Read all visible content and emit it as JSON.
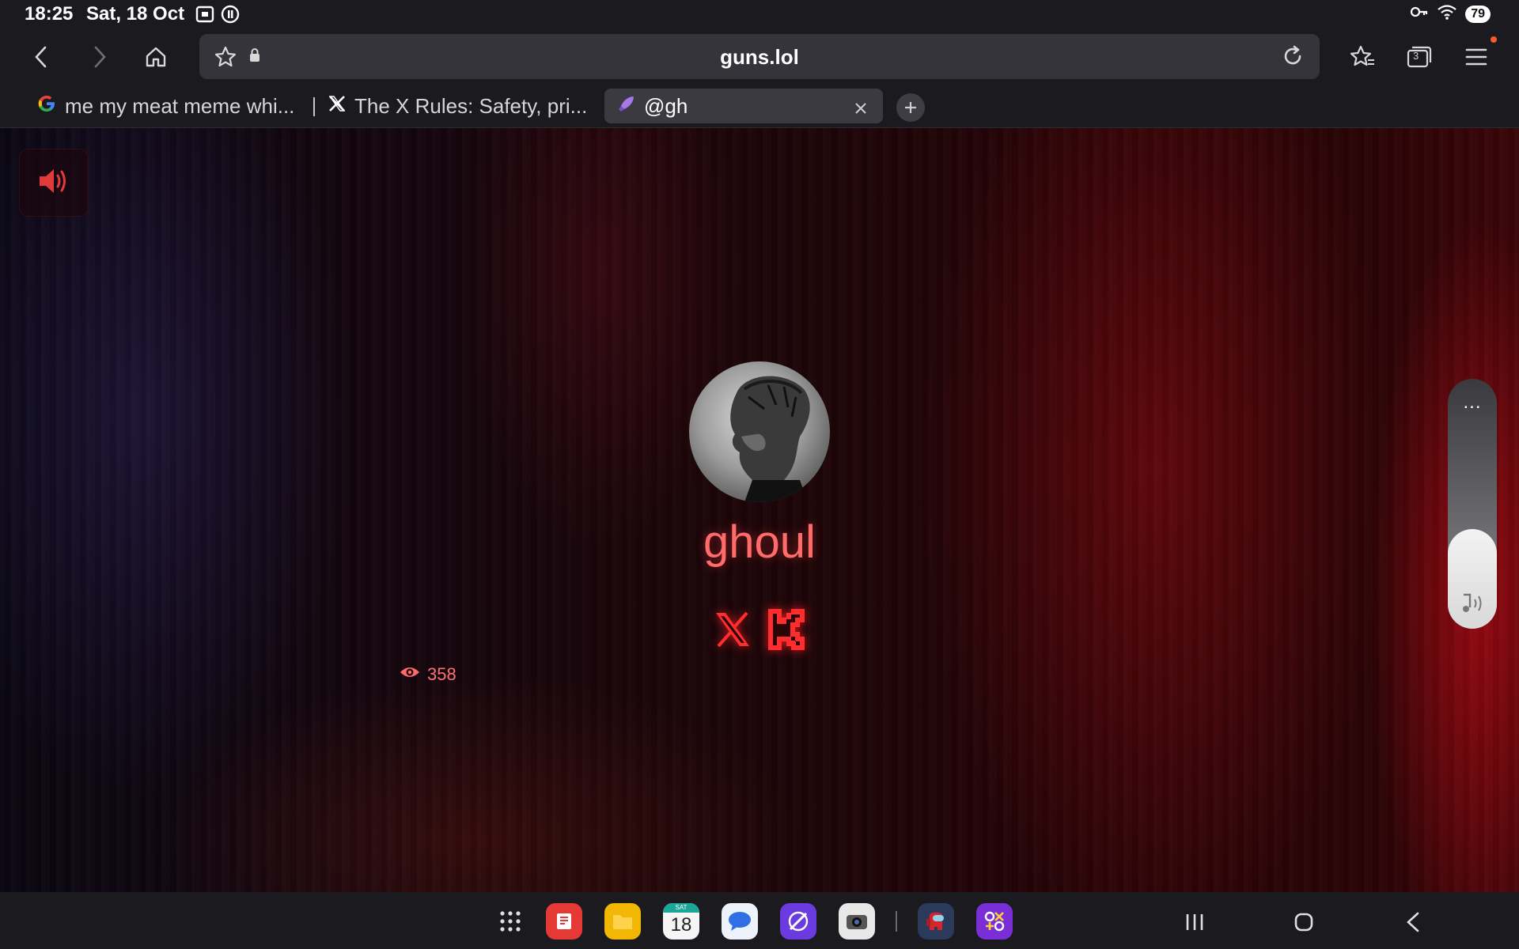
{
  "status_bar": {
    "time": "18:25",
    "date": "Sat, 18 Oct",
    "battery": "79",
    "left_icons": [
      "screen-record-icon",
      "alarm-icon"
    ],
    "right_icons": [
      "key-icon",
      "wifi-icon",
      "battery-icon"
    ]
  },
  "browser": {
    "url": "guns.lol",
    "tab_count": "3",
    "tabs": [
      {
        "title": "me my meat meme whi...",
        "favicon": "google-icon",
        "active": false
      },
      {
        "title": "The X Rules: Safety, pri...",
        "favicon": "x-logo-icon",
        "active": false
      },
      {
        "title": "@gh",
        "favicon": "rocket-icon",
        "active": true
      }
    ]
  },
  "profile": {
    "username": "ghoul",
    "views": "358",
    "socials": [
      "x-icon",
      "kick-icon"
    ]
  },
  "volume_panel": {
    "menu_label": "...",
    "level": 0.4
  },
  "dock": {
    "apps": [
      "app-drawer-icon",
      "notes-app-icon",
      "files-app-icon",
      "calendar-app-icon",
      "messages-app-icon",
      "internet-app-icon",
      "camera-app-icon",
      "among-us-app-icon",
      "games-app-icon"
    ],
    "calendar_day": "SAT",
    "calendar_date": "18"
  },
  "colors": {
    "accent": "#ff6b6b",
    "social": "#ff2d2d",
    "chrome_bg": "#1b1b1f"
  }
}
